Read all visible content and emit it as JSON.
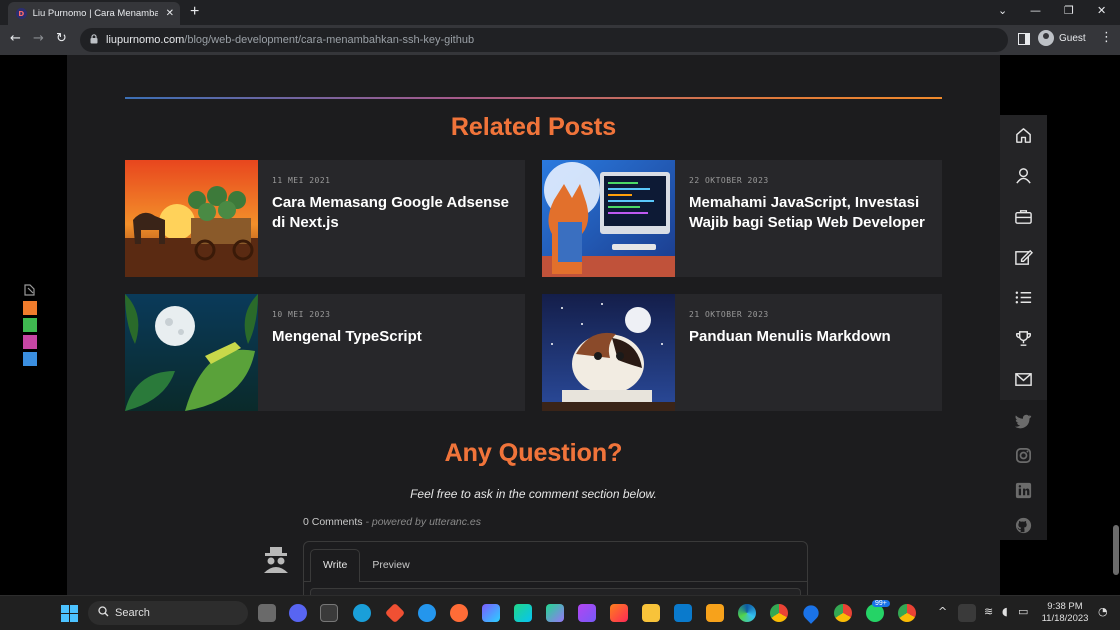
{
  "browser": {
    "tab_title": "Liu Purnomo | Cara Menambah",
    "tab_favicon": "D",
    "tab_close": "✕",
    "new_tab": "+",
    "url_host": "liupurnomo.com",
    "url_path": "/blog/web-development/cara-menambahkan-ssh-key-github",
    "profile_label": "Guest"
  },
  "related": {
    "heading": "Related Posts",
    "posts": [
      {
        "date": "11 MEI 2021",
        "title": "Cara Memasang Google Adsense di Next.js"
      },
      {
        "date": "22 OKTOBER 2023",
        "title": "Memahami JavaScript, Investasi Wajib bagi Setiap Web Developer"
      },
      {
        "date": "10 MEI 2023",
        "title": "Mengenal TypeScript"
      },
      {
        "date": "21 OKTOBER 2023",
        "title": "Panduan Menulis Markdown"
      }
    ]
  },
  "question": {
    "heading": "Any Question?",
    "subtitle": "Feel free to ask in the comment section below."
  },
  "comments": {
    "count_label": "0 Comments",
    "powered_by": " - powered by utteranc.es",
    "tab_write": "Write",
    "tab_preview": "Preview"
  },
  "theme_swatches": [
    "#f07c2c",
    "#3fb950",
    "#c646a4",
    "#3b8fe0"
  ],
  "sidebar": {
    "nav_icons": [
      "home-icon",
      "user-icon",
      "briefcase-icon",
      "edit-icon",
      "list-icon",
      "trophy-icon",
      "mail-icon"
    ],
    "social_icons": [
      "twitter-icon",
      "instagram-icon",
      "linkedin-icon",
      "github-icon"
    ]
  },
  "taskbar": {
    "search_label": "Search",
    "badge": "99+",
    "time": "9:38 PM",
    "date": "11/18/2023"
  }
}
